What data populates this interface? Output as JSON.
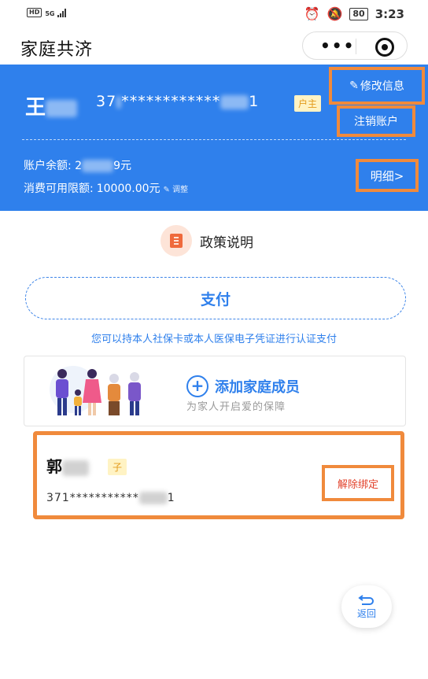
{
  "status_bar": {
    "left": "HD ⁵⁶.ıll",
    "hd": "HD",
    "network": "5G",
    "battery": "80",
    "time": "3:23"
  },
  "title_bar": {
    "title": "家庭共济",
    "more_icon": "ellipsis-icon",
    "close_icon": "target-icon"
  },
  "account": {
    "name": "王",
    "id_prefix": "37",
    "id_masked": "************",
    "id_suffix": "1",
    "role_tag": "户主",
    "edit_label": "修改信息",
    "cancel_label": "注销账户",
    "balance_label": "账户余额:",
    "balance_prefix": "2",
    "balance_suffix": "9元",
    "limit_label": "消费可用限额:",
    "limit_value": "10000.00元",
    "adjust_label": "调整",
    "detail_label": "明细>"
  },
  "policy": {
    "label": "政策说明",
    "icon": "document-icon"
  },
  "pay": {
    "label": "支付",
    "hint": "您可以持本人社保卡或本人医保电子凭证进行认证支付"
  },
  "add_member": {
    "title": "添加家庭成员",
    "subtitle": "为家人开启爱的保障"
  },
  "member": {
    "name": "郭",
    "tag": "子",
    "id_prefix": "371",
    "id_masked": "***********",
    "id_suffix": "1",
    "unbind_label": "解除绑定"
  },
  "back": {
    "label": "返回"
  },
  "colors": {
    "brand_blue": "#2f80ec",
    "highlight_orange": "#f08a3c",
    "tag_bg": "#fff3c4",
    "tag_text": "#e39a1b",
    "danger": "#e2412a"
  }
}
